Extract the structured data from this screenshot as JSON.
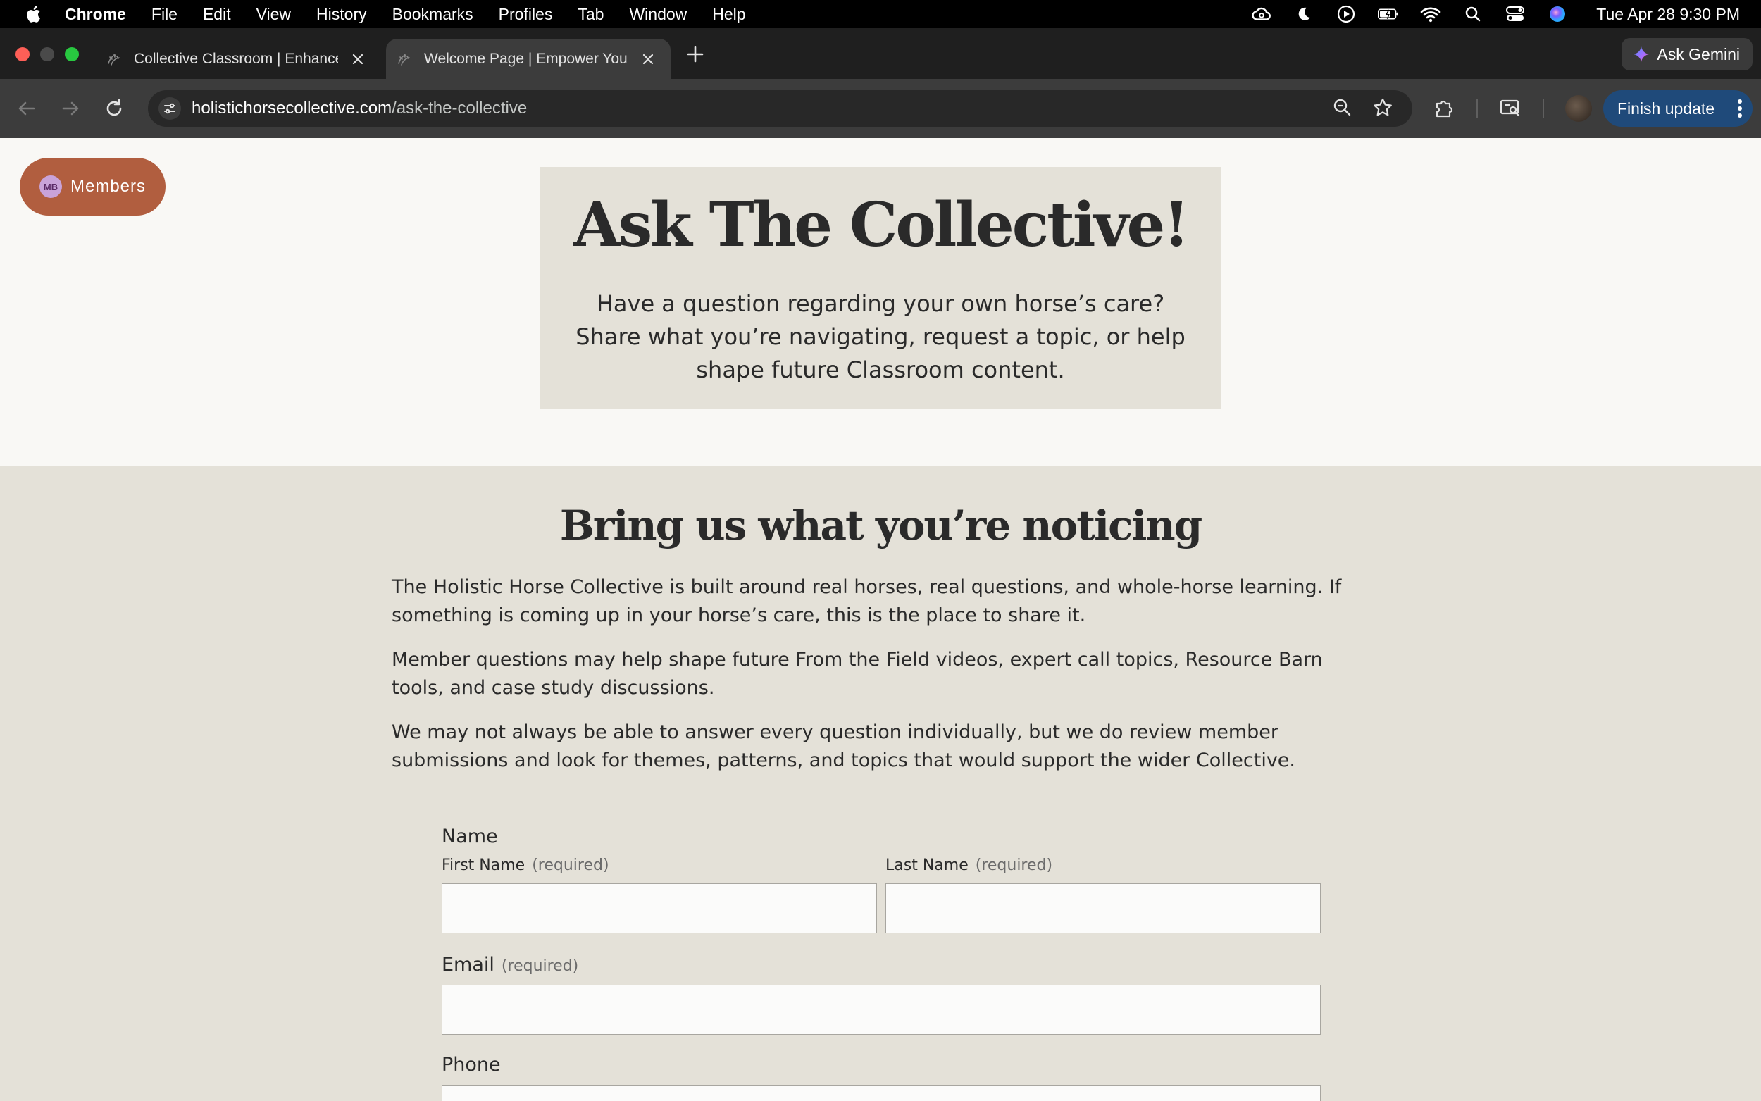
{
  "menubar": {
    "items": [
      "Chrome",
      "File",
      "Edit",
      "View",
      "History",
      "Bookmarks",
      "Profiles",
      "Tab",
      "Window",
      "Help"
    ],
    "clock": "Tue Apr 28  9:30 PM"
  },
  "tabs": [
    {
      "title": "Collective Classroom | Enhance"
    },
    {
      "title": "Welcome Page | Empower Your"
    }
  ],
  "gemini": {
    "label": "Ask Gemini"
  },
  "omnibox": {
    "host": "holistichorsecollective.com",
    "path": "/ask-the-collective"
  },
  "toolbar": {
    "finish_label": "Finish update"
  },
  "page": {
    "members_label": "Members",
    "members_avatar": "MB",
    "hero": {
      "title": "Ask The Collective!",
      "subtitle": "Have a question regarding your own horse’s care? Share what you’re navigating, request a topic, or help shape future Classroom content."
    },
    "section": {
      "heading": "Bring us what you’re noticing",
      "paragraphs": [
        "The Holistic Horse Collective is built around real horses, real questions, and whole-horse learning. If something is coming up in your horse’s care, this is the place to share it.",
        "Member questions may help shape future From the Field videos, expert call topics, Resource Barn tools, and case study discussions.",
        "We may not always be able to answer every question individually, but we do review member submissions and look for themes, patterns, and topics that would support the wider Collective."
      ]
    },
    "form": {
      "name_label": "Name",
      "first_name_label": "First Name",
      "last_name_label": "Last Name",
      "required": "(required)",
      "email_label": "Email",
      "phone_label": "Phone",
      "first_name_value": "",
      "last_name_value": "",
      "email_value": ""
    }
  }
}
